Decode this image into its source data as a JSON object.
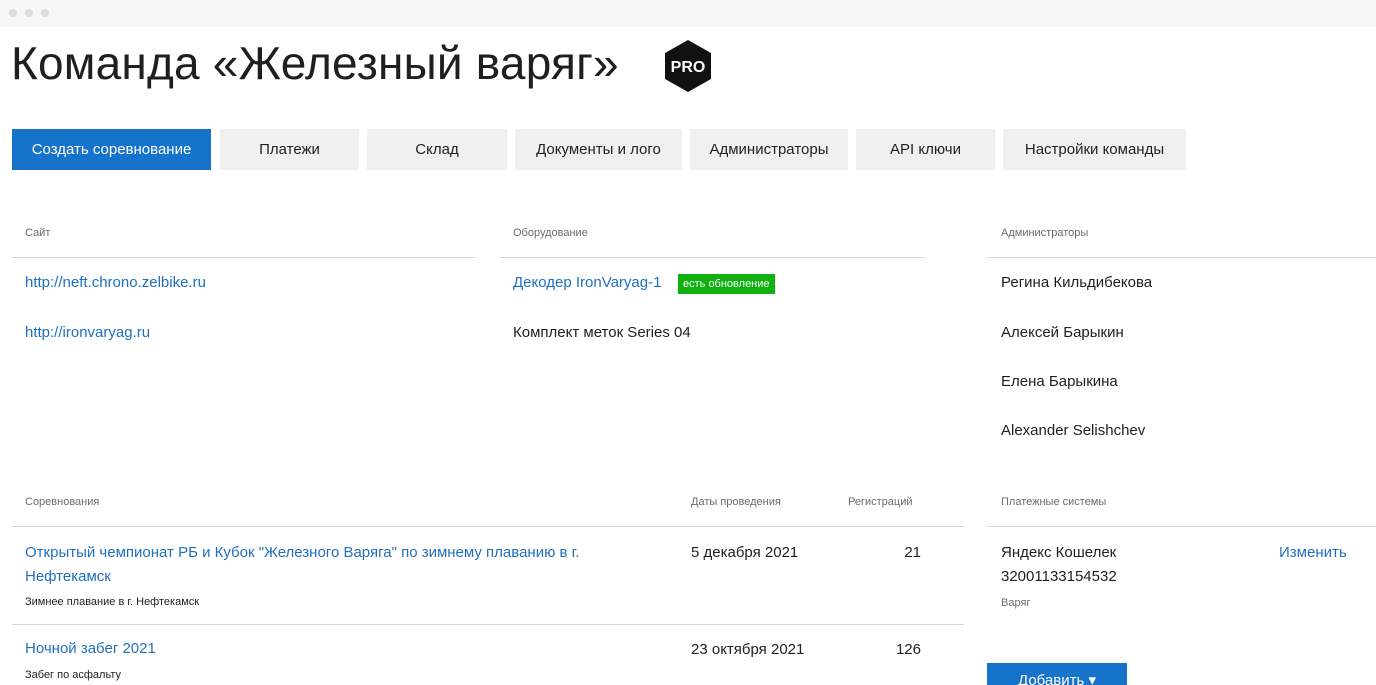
{
  "header": {
    "title": "Команда «Железный варяг»",
    "badge": "PRO"
  },
  "tabs": [
    {
      "label": "Создать соревнование"
    },
    {
      "label": "Платежи"
    },
    {
      "label": "Склад"
    },
    {
      "label": "Документы и лого"
    },
    {
      "label": "Администраторы"
    },
    {
      "label": "API ключи"
    },
    {
      "label": "Настройки команды"
    }
  ],
  "site": {
    "label": "Сайт",
    "links": [
      "http://neft.chrono.zelbike.ru",
      "http://ironvaryag.ru"
    ]
  },
  "equipment": {
    "label": "Оборудование",
    "items": [
      {
        "name": "Декодер IronVaryag-1",
        "badge": "есть обновление"
      },
      {
        "name": "Комплект меток Series 04"
      }
    ]
  },
  "admins": {
    "label": "Администраторы",
    "items": [
      "Регина Кильдибекова",
      "Алексей Барыкин",
      "Елена Барыкина",
      "Alexander Selishchev"
    ]
  },
  "competitions": {
    "label": "Соревнования",
    "col_dates": "Даты проведения",
    "col_regs": "Регистраций",
    "rows": [
      {
        "title": "Открытый чемпионат РБ и Кубок \"Железного Варяга\" по зимнему плаванию в г. Нефтекамск",
        "subtitle": "Зимнее плавание в г. Нефтекамск",
        "date": "5 декабря 2021",
        "regs": "21"
      },
      {
        "title": "Ночной забег 2021",
        "subtitle": "Забег по асфальту",
        "date": "23 октября 2021",
        "regs": "126"
      }
    ]
  },
  "payments": {
    "label": "Платежные системы",
    "items": [
      {
        "name": "Яндекс Кошелек",
        "account": "32001133154532",
        "note": "Варяг",
        "action": "Изменить"
      }
    ],
    "add_label": "Добавить ▾"
  }
}
